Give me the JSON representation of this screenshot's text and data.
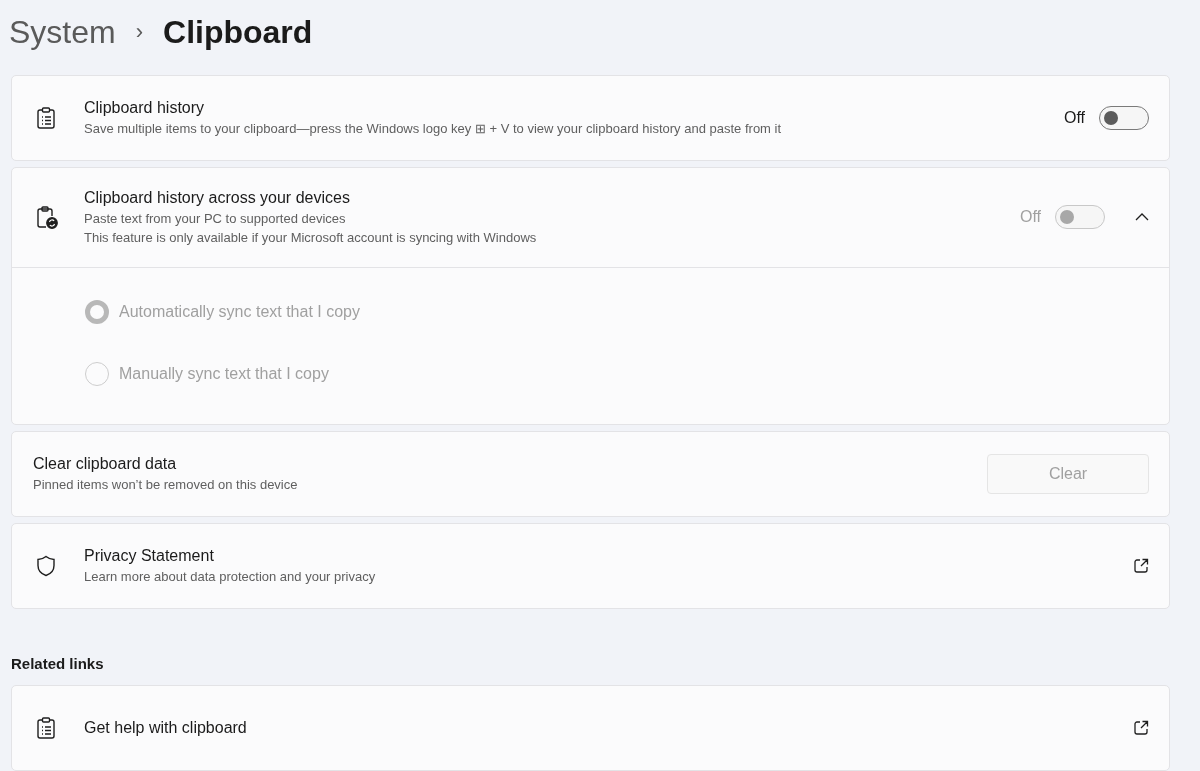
{
  "breadcrumb": {
    "parent": "System",
    "separator": "›",
    "current": "Clipboard"
  },
  "cards": [
    {
      "kind": "toggle",
      "title": "Clipboard history",
      "lines": [
        "Save multiple items to your clipboard—press the Windows logo key ⊞ + V to view your clipboard history and paste from it"
      ],
      "state": "Off",
      "on": false,
      "disabled": false
    },
    {
      "kind": "expander",
      "title": "Clipboard history across your devices",
      "lines": [
        "Paste text from your PC to supported devices",
        "This feature is only available if your Microsoft account is syncing with Windows"
      ],
      "state": "Off",
      "on": false,
      "disabled": true,
      "expanded": true,
      "options": [
        {
          "label": "Automatically sync text that I copy",
          "selected": true
        },
        {
          "label": "Manually sync text that I copy",
          "selected": false
        }
      ]
    },
    {
      "kind": "button",
      "title": "Clear clipboard data",
      "lines": [
        "Pinned items won’t be removed on this device"
      ],
      "button": "Clear",
      "disabled": true
    },
    {
      "kind": "link",
      "title": "Privacy Statement",
      "lines": [
        "Learn more about data protection and your privacy"
      ]
    }
  ],
  "related": {
    "heading": "Related links",
    "cards": [
      {
        "kind": "link",
        "title": "Get help with clipboard"
      }
    ]
  }
}
